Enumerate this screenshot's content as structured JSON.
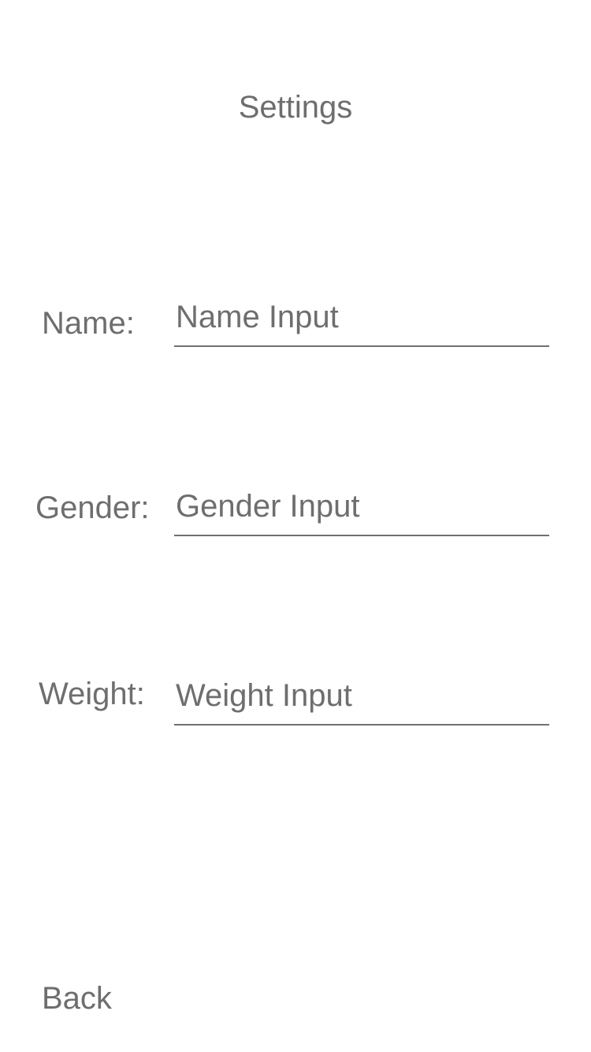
{
  "header": {
    "title": "Settings"
  },
  "form": {
    "fields": [
      {
        "label": "Name:",
        "value": "",
        "placeholder": "Name Input"
      },
      {
        "label": "Gender:",
        "value": "",
        "placeholder": "Gender Input"
      },
      {
        "label": "Weight:",
        "value": "",
        "placeholder": "Weight Input"
      }
    ]
  },
  "footer": {
    "back_label": "Back"
  },
  "colors": {
    "text": "#6e6e6e",
    "underline": "#707070",
    "background": "#ffffff"
  }
}
